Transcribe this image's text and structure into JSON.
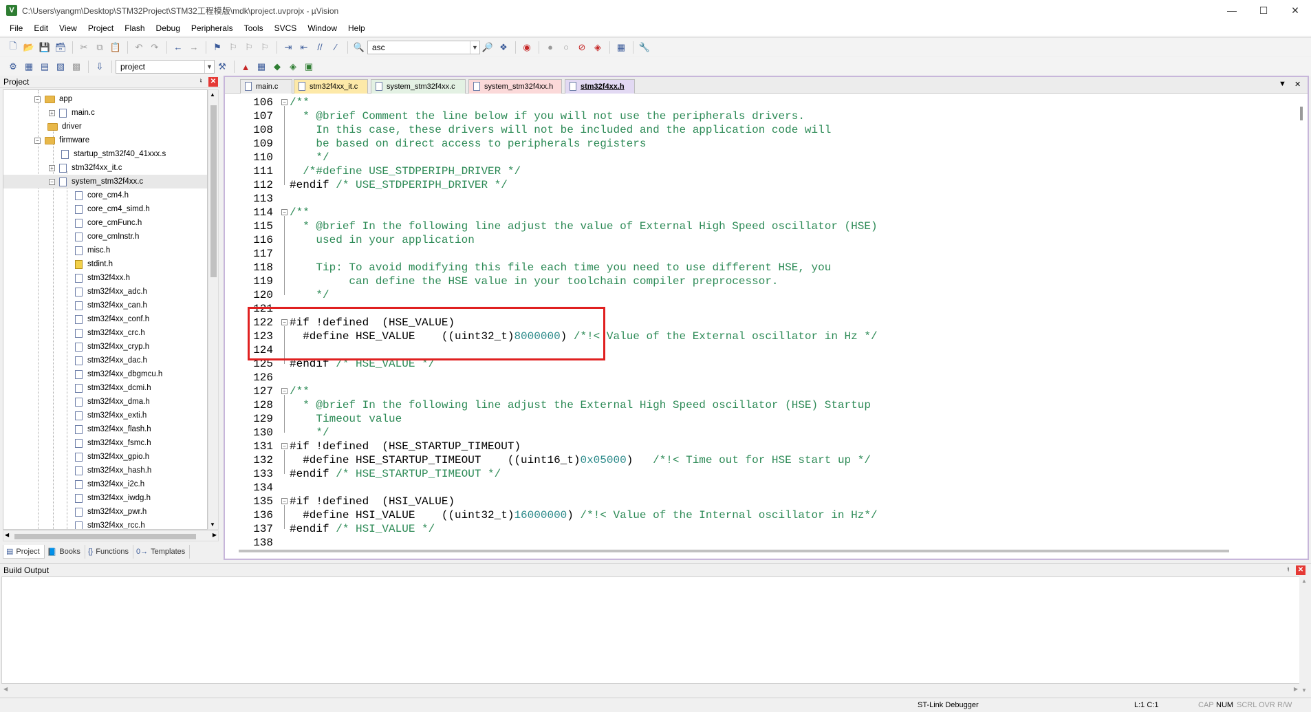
{
  "window": {
    "title": "C:\\Users\\yangm\\Desktop\\STM32Project\\STM32工程模版\\mdk\\project.uvprojx - µVision",
    "app_icon": "V"
  },
  "menu": [
    "File",
    "Edit",
    "View",
    "Project",
    "Flash",
    "Debug",
    "Peripherals",
    "Tools",
    "SVCS",
    "Window",
    "Help"
  ],
  "toolbar": {
    "find_value": "asc",
    "target_value": "project"
  },
  "project_panel": {
    "title": "Project",
    "tree": [
      {
        "label": "app",
        "type": "folder",
        "expander": "⊟"
      },
      {
        "label": "main.c",
        "type": "file",
        "expander": "⊞"
      },
      {
        "label": "driver",
        "type": "folder",
        "expander": ""
      },
      {
        "label": "firmware",
        "type": "folder",
        "expander": "⊟"
      },
      {
        "label": "startup_stm32f40_41xxx.s",
        "type": "file",
        "expander": ""
      },
      {
        "label": "stm32f4xx_it.c",
        "type": "file",
        "expander": "⊞"
      },
      {
        "label": "system_stm32f4xx.c",
        "type": "file",
        "expander": "⊟"
      },
      {
        "label": "core_cm4.h",
        "type": "file",
        "expander": ""
      },
      {
        "label": "core_cm4_simd.h",
        "type": "file",
        "expander": ""
      },
      {
        "label": "core_cmFunc.h",
        "type": "file",
        "expander": ""
      },
      {
        "label": "core_cmInstr.h",
        "type": "file",
        "expander": ""
      },
      {
        "label": "misc.h",
        "type": "file",
        "expander": ""
      },
      {
        "label": "stdint.h",
        "type": "lock",
        "expander": ""
      },
      {
        "label": "stm32f4xx.h",
        "type": "file",
        "expander": ""
      },
      {
        "label": "stm32f4xx_adc.h",
        "type": "file",
        "expander": ""
      },
      {
        "label": "stm32f4xx_can.h",
        "type": "file",
        "expander": ""
      },
      {
        "label": "stm32f4xx_conf.h",
        "type": "file",
        "expander": ""
      },
      {
        "label": "stm32f4xx_crc.h",
        "type": "file",
        "expander": ""
      },
      {
        "label": "stm32f4xx_cryp.h",
        "type": "file",
        "expander": ""
      },
      {
        "label": "stm32f4xx_dac.h",
        "type": "file",
        "expander": ""
      },
      {
        "label": "stm32f4xx_dbgmcu.h",
        "type": "file",
        "expander": ""
      },
      {
        "label": "stm32f4xx_dcmi.h",
        "type": "file",
        "expander": ""
      },
      {
        "label": "stm32f4xx_dma.h",
        "type": "file",
        "expander": ""
      },
      {
        "label": "stm32f4xx_exti.h",
        "type": "file",
        "expander": ""
      },
      {
        "label": "stm32f4xx_flash.h",
        "type": "file",
        "expander": ""
      },
      {
        "label": "stm32f4xx_fsmc.h",
        "type": "file",
        "expander": ""
      },
      {
        "label": "stm32f4xx_gpio.h",
        "type": "file",
        "expander": ""
      },
      {
        "label": "stm32f4xx_hash.h",
        "type": "file",
        "expander": ""
      },
      {
        "label": "stm32f4xx_i2c.h",
        "type": "file",
        "expander": ""
      },
      {
        "label": "stm32f4xx_iwdg.h",
        "type": "file",
        "expander": ""
      },
      {
        "label": "stm32f4xx_pwr.h",
        "type": "file",
        "expander": ""
      },
      {
        "label": "stm32f4xx_rcc.h",
        "type": "file",
        "expander": ""
      }
    ],
    "tabs": [
      {
        "label": "Project",
        "icon": "project-icon"
      },
      {
        "label": "Books",
        "icon": "books-icon"
      },
      {
        "label": "Functions",
        "icon": "functions-icon"
      },
      {
        "label": "Templates",
        "icon": "templates-icon"
      }
    ]
  },
  "editor": {
    "tabs": [
      {
        "label": "main.c",
        "color": "#ececec"
      },
      {
        "label": "stm32f4xx_it.c",
        "color": "#fde9a8"
      },
      {
        "label": "system_stm32f4xx.c",
        "color": "#e3f1e3"
      },
      {
        "label": "system_stm32f4xx.h",
        "color": "#fbd9d9"
      },
      {
        "label": "stm32f4xx.h",
        "color": "#e2d9f3"
      }
    ],
    "active_tab": "stm32f4xx.h",
    "lines": [
      {
        "n": "106",
        "t": [
          [
            "c",
            "/**"
          ]
        ]
      },
      {
        "n": "107",
        "t": [
          [
            "c",
            "  * @brief Comment the line below if you will not use the peripherals drivers."
          ]
        ]
      },
      {
        "n": "108",
        "t": [
          [
            "c",
            "    In this case, these drivers will not be included and the application code will"
          ]
        ]
      },
      {
        "n": "109",
        "t": [
          [
            "c",
            "    be based on direct access to peripherals registers"
          ]
        ]
      },
      {
        "n": "110",
        "t": [
          [
            "c",
            "    */"
          ]
        ]
      },
      {
        "n": "111",
        "t": [
          [
            "c",
            "  /*#define USE_STDPERIPH_DRIVER */"
          ]
        ]
      },
      {
        "n": "112",
        "t": [
          [
            "k",
            "#endif "
          ],
          [
            "c",
            "/* USE_STDPERIPH_DRIVER */"
          ]
        ]
      },
      {
        "n": "113",
        "t": []
      },
      {
        "n": "114",
        "t": [
          [
            "c",
            "/**"
          ]
        ]
      },
      {
        "n": "115",
        "t": [
          [
            "c",
            "  * @brief In the following line adjust the value of External High Speed oscillator (HSE)"
          ]
        ]
      },
      {
        "n": "116",
        "t": [
          [
            "c",
            "    used in your application"
          ]
        ]
      },
      {
        "n": "117",
        "t": []
      },
      {
        "n": "118",
        "t": [
          [
            "c",
            "    Tip: To avoid modifying this file each time you need to use different HSE, you"
          ]
        ]
      },
      {
        "n": "119",
        "t": [
          [
            "c",
            "         can define the HSE value in your toolchain compiler preprocessor."
          ]
        ]
      },
      {
        "n": "120",
        "t": [
          [
            "c",
            "    */"
          ]
        ]
      },
      {
        "n": "121",
        "t": []
      },
      {
        "n": "122",
        "t": [
          [
            "k",
            "#if !defined  (HSE_VALUE)"
          ]
        ]
      },
      {
        "n": "123",
        "t": [
          [
            "k",
            "  #define HSE_VALUE    ((uint32_t)"
          ],
          [
            "n",
            "8000000"
          ],
          [
            "k",
            ") "
          ],
          [
            "c",
            "/*!< Value of the External oscillator in Hz */"
          ]
        ]
      },
      {
        "n": "124",
        "t": []
      },
      {
        "n": "125",
        "t": [
          [
            "k",
            "#endif "
          ],
          [
            "c",
            "/* HSE_VALUE */"
          ]
        ]
      },
      {
        "n": "126",
        "t": []
      },
      {
        "n": "127",
        "t": [
          [
            "c",
            "/**"
          ]
        ]
      },
      {
        "n": "128",
        "t": [
          [
            "c",
            "  * @brief In the following line adjust the External High Speed oscillator (HSE) Startup"
          ]
        ]
      },
      {
        "n": "129",
        "t": [
          [
            "c",
            "    Timeout value"
          ]
        ]
      },
      {
        "n": "130",
        "t": [
          [
            "c",
            "    */"
          ]
        ]
      },
      {
        "n": "131",
        "t": [
          [
            "k",
            "#if !defined  (HSE_STARTUP_TIMEOUT)"
          ]
        ]
      },
      {
        "n": "132",
        "t": [
          [
            "k",
            "  #define HSE_STARTUP_TIMEOUT    ((uint16_t)"
          ],
          [
            "n",
            "0x05000"
          ],
          [
            "k",
            ")   "
          ],
          [
            "c",
            "/*!< Time out for HSE start up */"
          ]
        ]
      },
      {
        "n": "133",
        "t": [
          [
            "k",
            "#endif "
          ],
          [
            "c",
            "/* HSE_STARTUP_TIMEOUT */"
          ]
        ]
      },
      {
        "n": "134",
        "t": []
      },
      {
        "n": "135",
        "t": [
          [
            "k",
            "#if !defined  (HSI_VALUE)"
          ]
        ]
      },
      {
        "n": "136",
        "t": [
          [
            "k",
            "  #define HSI_VALUE    ((uint32_t)"
          ],
          [
            "n",
            "16000000"
          ],
          [
            "k",
            ") "
          ],
          [
            "c",
            "/*!< Value of the Internal oscillator in Hz*/"
          ]
        ]
      },
      {
        "n": "137",
        "t": [
          [
            "k",
            "#endif "
          ],
          [
            "c",
            "/* HSI_VALUE */"
          ]
        ]
      },
      {
        "n": "138",
        "t": []
      }
    ]
  },
  "build_output": {
    "title": "Build Output"
  },
  "status_bar": {
    "debugger": "ST-Link Debugger",
    "position": "L:1 C:1",
    "indicators": [
      {
        "label": "CAP",
        "on": false
      },
      {
        "label": "NUM",
        "on": true
      },
      {
        "label": "SCRL",
        "on": false
      },
      {
        "label": "OVR",
        "on": false
      },
      {
        "label": "R/W",
        "on": false
      }
    ]
  },
  "colors": {
    "comment": "#2e8b57",
    "number": "#2b8a8a",
    "highlight_box": "#e02020",
    "editor_border": "#c7b6da"
  }
}
